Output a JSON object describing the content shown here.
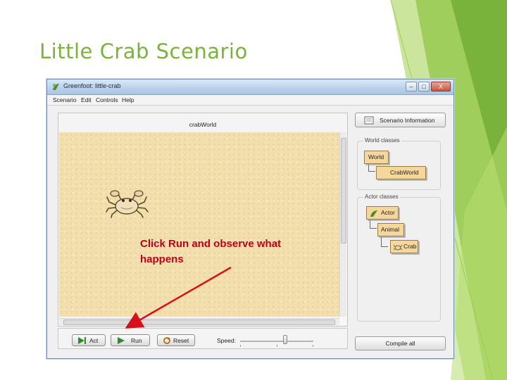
{
  "slide": {
    "title": "Little Crab Scenario",
    "annotation_line1": "Click Run and observe what",
    "annotation_line2": "happens",
    "accent_color": "#7bb33a",
    "annotation_color": "#c0001a"
  },
  "window": {
    "title": "Greenfoot: little-crab",
    "controls": {
      "minimize": "–",
      "maximize": "□",
      "close": "X"
    }
  },
  "menubar": {
    "items": [
      "Scenario",
      "Edit",
      "Controls",
      "Help"
    ]
  },
  "world": {
    "title": "crabWorld",
    "actor_icon": "crab-icon"
  },
  "sidebar": {
    "scenario_info_label": "Scenario Information",
    "world_classes_label": "World classes",
    "actor_classes_label": "Actor classes",
    "world_classes": [
      "World",
      "CrabWorld"
    ],
    "actor_classes": [
      "Actor",
      "Animal",
      "Crab"
    ],
    "compile_label": "Compile all"
  },
  "controls": {
    "act_label": "Act",
    "run_label": "Run",
    "reset_label": "Reset",
    "speed_label": "Speed:",
    "speed_level": 0.62
  }
}
